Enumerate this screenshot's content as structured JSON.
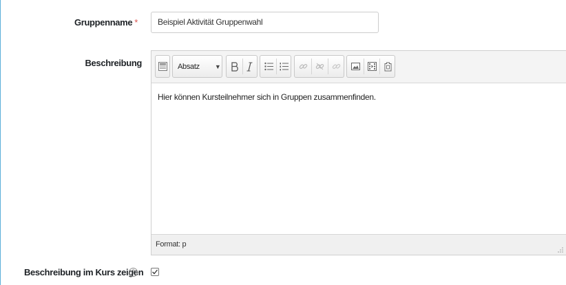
{
  "form": {
    "group_name": {
      "label": "Gruppenname",
      "required_marker": "*",
      "value": "Beispiel Aktivität Gruppenwahl"
    },
    "description": {
      "label": "Beschreibung",
      "toolbar": {
        "paragraph_select": "Absatz",
        "buttons": [
          "toggle-toolbar",
          "format-select",
          "bold",
          "italic",
          "unordered-list",
          "ordered-list",
          "link",
          "unlink",
          "link-disabled",
          "image",
          "media",
          "manage-files"
        ]
      },
      "content": "Hier können Kursteilnehmer sich in Gruppen zusammenfinden.",
      "status": "Format: p"
    },
    "show_description": {
      "label": "Beschreibung im Kurs zeigen",
      "help_glyph": "?",
      "checked": true,
      "check_glyph": "✓"
    }
  },
  "colors": {
    "accent_border": "#5aaed8",
    "required": "#d9534f"
  }
}
